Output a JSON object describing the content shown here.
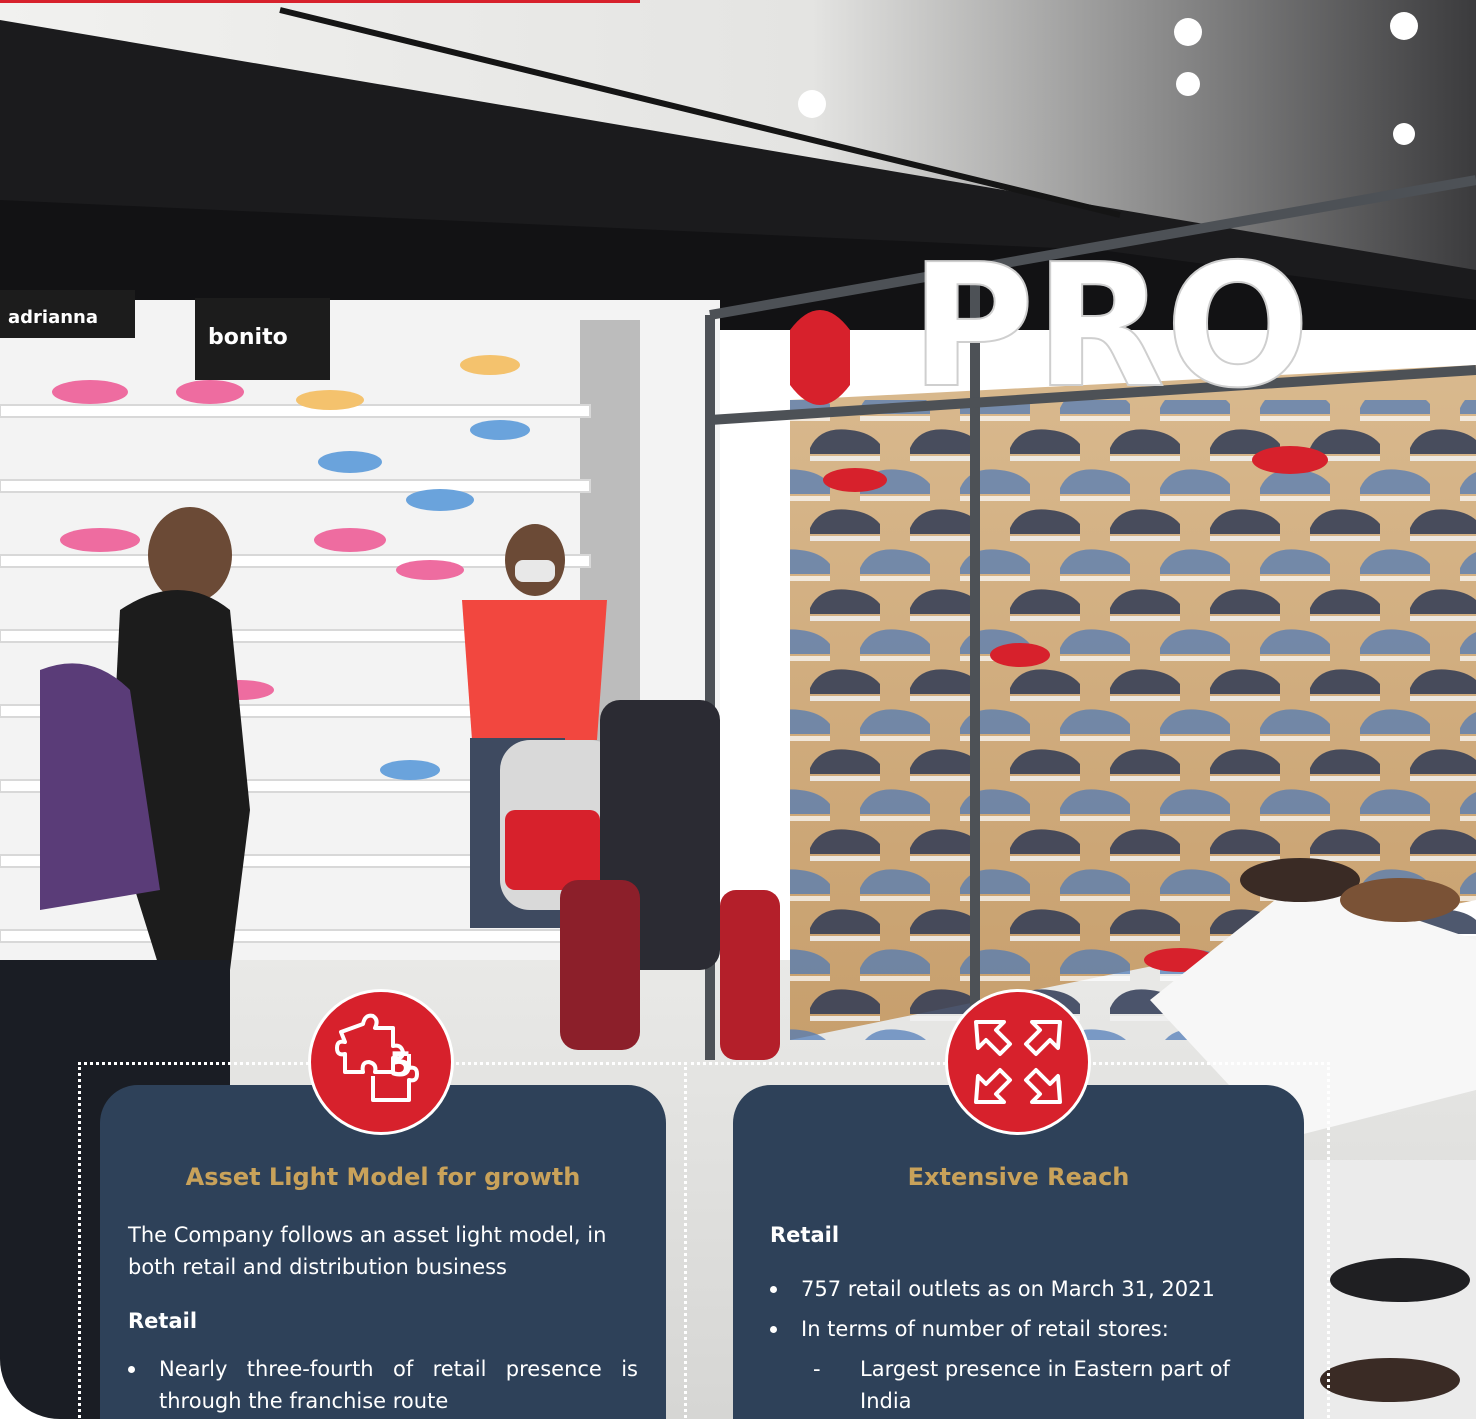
{
  "card_left": {
    "title": "Asset Light Model for growth",
    "intro": "The Company follows an asset light model, in both retail and distribution business",
    "subheading": "Retail",
    "bullets": [
      "Nearly three-fourth of retail presence is through the franchise route"
    ],
    "icon": "puzzle-icon"
  },
  "card_right": {
    "title": "Extensive Reach",
    "subheading": "Retail",
    "bullets": [
      "757 retail outlets as on March 31, 2021",
      "In terms of number of retail stores:"
    ],
    "sub_bullets": [
      "Largest presence in Eastern part of India"
    ],
    "sub_bullet_marker": "-",
    "icon": "expand-arrows-icon"
  },
  "photo": {
    "signs": [
      "adrianna",
      "bonito",
      "PRO"
    ]
  },
  "colors": {
    "accent": "#d7212c",
    "card_bg": "#2e4159",
    "title_gold": "#c9a25a"
  }
}
